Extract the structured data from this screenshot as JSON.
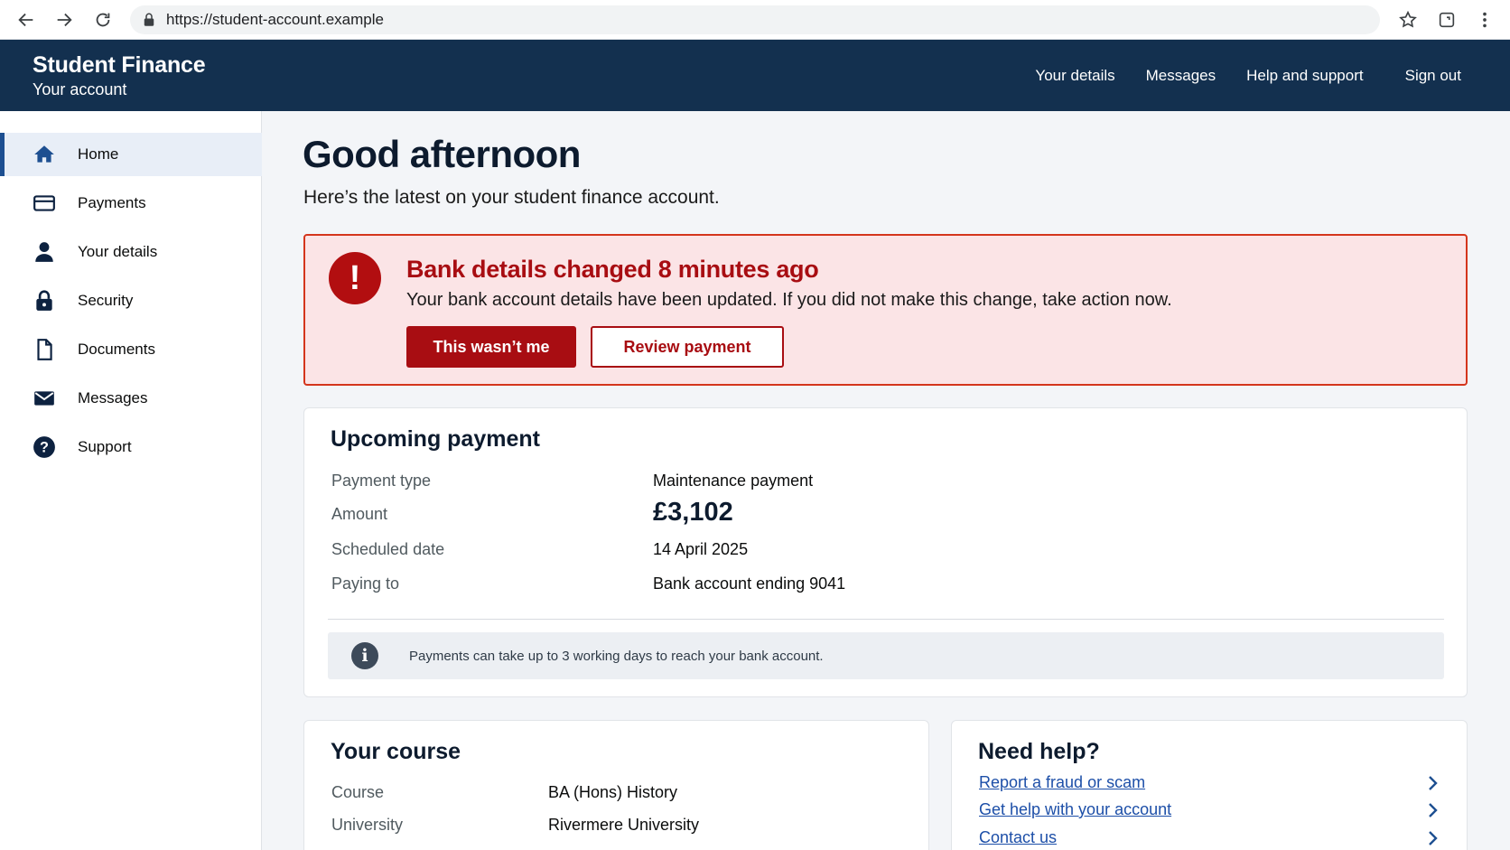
{
  "browser": {
    "url": "https://student-account.example"
  },
  "header": {
    "title": "Student Finance",
    "subtitle": "Your account",
    "nav": [
      {
        "label": "Your details"
      },
      {
        "label": "Messages"
      },
      {
        "label": "Help and support"
      },
      {
        "label": "Sign out"
      }
    ]
  },
  "sidebar": {
    "items": [
      {
        "label": "Home",
        "icon": "home-icon",
        "active": true
      },
      {
        "label": "Payments",
        "icon": "card-icon"
      },
      {
        "label": "Your details",
        "icon": "person-icon"
      },
      {
        "label": "Security",
        "icon": "lock-icon"
      },
      {
        "label": "Documents",
        "icon": "document-icon"
      },
      {
        "label": "Messages",
        "icon": "envelope-icon"
      },
      {
        "label": "Support",
        "icon": "question-icon"
      }
    ]
  },
  "main": {
    "greeting": "Good afternoon",
    "intro": "Here’s the latest on your student finance account."
  },
  "alert": {
    "icon": "!",
    "title": "Bank details changed 8 minutes ago",
    "text": "Your bank account details have been updated. If you did not make this change, take action now.",
    "primary_button": "This wasn’t me",
    "secondary_button": "Review payment",
    "color": "#a80d12"
  },
  "payment": {
    "title": "Upcoming payment",
    "rows": [
      {
        "label": "Payment type",
        "value": "Maintenance payment"
      },
      {
        "label": "Amount",
        "value": "£3,102"
      },
      {
        "label": "Scheduled date",
        "value": "14 April 2025"
      },
      {
        "label": "Paying to",
        "value": "Bank account ending 9041"
      }
    ],
    "info_icon": "i",
    "info": "Payments can take up to 3 working days to reach your bank account."
  },
  "course": {
    "title": "Your course",
    "rows": [
      {
        "label": "Course",
        "value": "BA (Hons) History"
      },
      {
        "label": "University",
        "value": "Rivermere University"
      }
    ]
  },
  "help": {
    "title": "Need help?",
    "links": [
      {
        "label": "Report a fraud or scam"
      },
      {
        "label": "Get help with your account"
      },
      {
        "label": "Contact us"
      }
    ]
  }
}
